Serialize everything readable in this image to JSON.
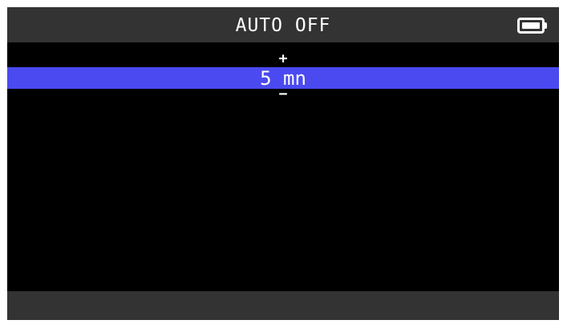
{
  "header": {
    "title": "AUTO OFF",
    "battery_icon": "battery-full-icon"
  },
  "selector": {
    "increment_label": "+",
    "value": "5 mn",
    "decrement_label": "−"
  },
  "colors": {
    "screen_background": "#000000",
    "bar_background": "#333333",
    "highlight": "#4a4af0",
    "text": "#ffffff"
  }
}
